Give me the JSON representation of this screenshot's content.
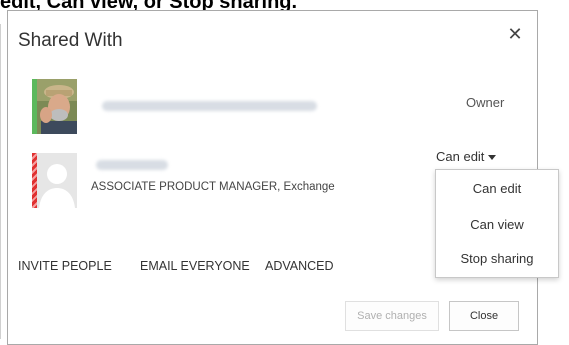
{
  "caption": "edit, Can view, or Stop sharing.",
  "dialog": {
    "title": "Shared With",
    "close_glyph": "✕"
  },
  "people": [
    {
      "role": "Owner"
    },
    {
      "job_title": "ASSOCIATE PRODUCT MANAGER, Exchange",
      "permission": "Can edit"
    }
  ],
  "dropdown": {
    "options": [
      "Can edit",
      "Can view",
      "Stop sharing"
    ]
  },
  "actions": {
    "invite": "INVITE PEOPLE",
    "email": "EMAIL EVERYONE",
    "advanced": "ADVANCED"
  },
  "buttons": {
    "save": "Save changes",
    "close": "Close"
  },
  "colors": {
    "presence_available": "#5cb85c",
    "presence_busy": "#e03030"
  },
  "icons": {
    "close": "close-icon",
    "caret": "chevron-down-icon",
    "default_avatar": "person-placeholder-icon"
  }
}
